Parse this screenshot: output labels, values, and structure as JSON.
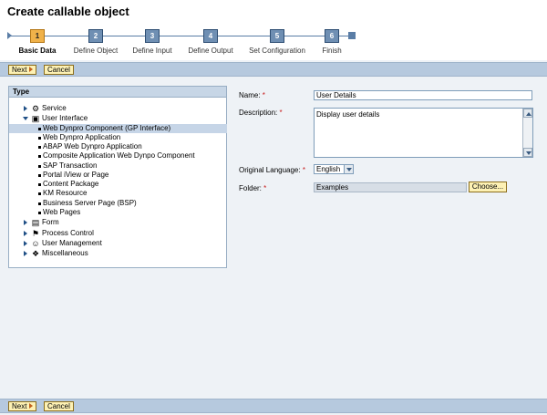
{
  "page": {
    "title": "Create callable object"
  },
  "roadmap": {
    "steps": [
      {
        "number": "1",
        "label": "Basic Data"
      },
      {
        "number": "2",
        "label": "Define Object"
      },
      {
        "number": "3",
        "label": "Define Input"
      },
      {
        "number": "4",
        "label": "Define Output"
      },
      {
        "number": "5",
        "label": "Set Configuration"
      },
      {
        "number": "6",
        "label": "Finish"
      }
    ],
    "active_step": "1"
  },
  "toolbar": {
    "next_label": "Next",
    "cancel_label": "Cancel"
  },
  "type_panel": {
    "header": "Type",
    "items": [
      {
        "label": "Service",
        "icon": "gear-icon"
      },
      {
        "label": "User Interface",
        "icon": "user-interface-icon"
      },
      {
        "label": "Web Dynpro Component (GP Interface)"
      },
      {
        "label": "Web Dynpro Application"
      },
      {
        "label": "ABAP Web Dynpro Application"
      },
      {
        "label": "Composite Application Web Dynpo Component"
      },
      {
        "label": "SAP Transaction"
      },
      {
        "label": "Portal iView or Page"
      },
      {
        "label": "Content Package"
      },
      {
        "label": "KM Resource"
      },
      {
        "label": "Business Server Page (BSP)"
      },
      {
        "label": "Web Pages"
      },
      {
        "label": "Form",
        "icon": "form-icon"
      },
      {
        "label": "Process Control",
        "icon": "process-control-icon"
      },
      {
        "label": "User Management",
        "icon": "user-management-icon"
      },
      {
        "label": "Miscellaneous",
        "icon": "miscellaneous-icon"
      }
    ]
  },
  "form": {
    "name_label": "Name:",
    "name_value": "User Details",
    "description_label": "Description:",
    "description_value": "Display user details",
    "language_label": "Original Language:",
    "language_value": "English",
    "folder_label": "Folder:",
    "folder_value": "Examples",
    "choose_label": "Choose...",
    "required_marker": "*"
  },
  "colors": {
    "toolbar_bg": "#b6c9de",
    "active_step": "#f0b24a",
    "step": "#6f8fb3",
    "button_bg": "#fdf1b4",
    "required": "#c81e1e",
    "selected_row": "#c6d5e7"
  }
}
